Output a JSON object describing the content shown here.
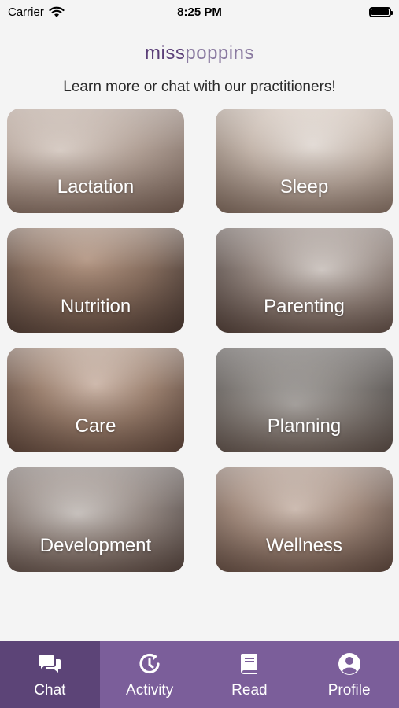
{
  "status_bar": {
    "carrier": "Carrier",
    "time": "8:25 PM",
    "wifi_icon": "wifi-icon",
    "battery_icon": "battery-icon"
  },
  "header": {
    "logo_part1": "miss",
    "logo_part2": "poppins",
    "subtitle": "Learn more or chat with our practitioners!"
  },
  "topics": [
    {
      "label": "Lactation"
    },
    {
      "label": "Sleep"
    },
    {
      "label": "Nutrition"
    },
    {
      "label": "Parenting"
    },
    {
      "label": "Care"
    },
    {
      "label": "Planning"
    },
    {
      "label": "Development"
    },
    {
      "label": "Wellness"
    }
  ],
  "tab_bar": {
    "tabs": [
      {
        "label": "Chat",
        "icon": "chat-icon",
        "active": true
      },
      {
        "label": "Activity",
        "icon": "activity-icon",
        "active": false
      },
      {
        "label": "Read",
        "icon": "book-icon",
        "active": false
      },
      {
        "label": "Profile",
        "icon": "profile-icon",
        "active": false
      }
    ]
  },
  "colors": {
    "brand_purple": "#7b5e9a",
    "active_tab": "#5c4477",
    "logo_dark": "#5b3f78",
    "logo_light": "#8a7aa0"
  }
}
